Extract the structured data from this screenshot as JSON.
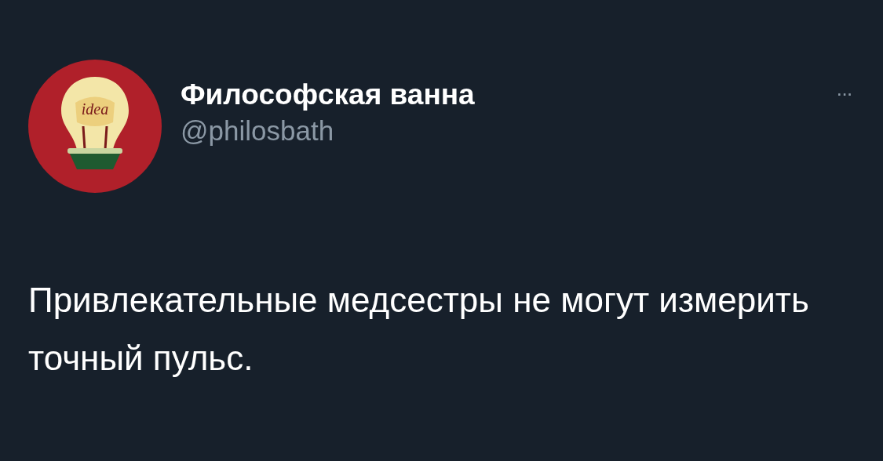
{
  "author": {
    "name": "Философская ванна",
    "handle": "@philosbath",
    "avatar_text": "idea"
  },
  "more": "···",
  "text": "Привлекательные медсестры не могут измерить точный пульс."
}
